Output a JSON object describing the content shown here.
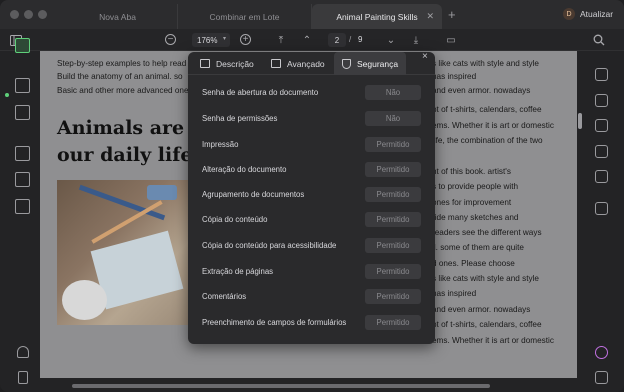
{
  "tabs": [
    {
      "label": "Nova Aba",
      "active": false
    },
    {
      "label": "Combinar em Lote",
      "active": false
    },
    {
      "label": "Animal Painting Skills",
      "active": true
    }
  ],
  "header": {
    "update_avatar": "D",
    "update_label": "Atualizar"
  },
  "toolbar": {
    "zoom": "176%",
    "page_current": "2",
    "page_sep": "/",
    "page_total": "9"
  },
  "document": {
    "top_lines": [
      "Step-by-step examples to help read",
      "Build the anatomy of an animal. so",
      "Basic and other more advanced one"
    ],
    "title_lines": [
      "Animals are a",
      "our daily life"
    ],
    "right_lines": [
      "s like cats with style and style",
      "has inspired",
      "and even armor. nowadays",
      "pt of t-shirts, calendars, coffee",
      "ems. Whether it is art or domestic",
      "life, the combination of the two",
      "",
      "nt of this book. artist's",
      "s to provide people with",
      "ones for improvement",
      "ride many sketches and",
      "readers see the different ways",
      "ll. some of them are quite",
      "d ones. Please choose",
      "s like cats with style and style",
      "has inspired",
      "and even armor. nowadays",
      "pt of t-shirts, calendars, coffee",
      "ems. Whether it is art or domestic"
    ]
  },
  "properties": {
    "tabs": [
      "Descrição",
      "Avançado",
      "Segurança"
    ],
    "active_tab": "Segurança",
    "close": "×",
    "rows": [
      {
        "label": "Senha de abertura do documento",
        "value": "Não"
      },
      {
        "label": "Senha de permissões",
        "value": "Não"
      },
      {
        "label": "Impressão",
        "value": "Permitido"
      },
      {
        "label": "Alteração do documento",
        "value": "Permitido"
      },
      {
        "label": "Agrupamento de documentos",
        "value": "Permitido"
      },
      {
        "label": "Cópia do conteúdo",
        "value": "Permitido"
      },
      {
        "label": "Cópia do conteúdo para acessibilidade",
        "value": "Permitido"
      },
      {
        "label": "Extração de páginas",
        "value": "Permitido"
      },
      {
        "label": "Comentários",
        "value": "Permitido"
      },
      {
        "label": "Preenchimento de campos de formulários",
        "value": "Permitido"
      }
    ]
  },
  "icons": {
    "zoom_out": "−",
    "zoom_in": "+",
    "first_page": "⤒",
    "prev_page": "⌃",
    "next_page": "⌄",
    "last_page": "⤓",
    "comment": "▭",
    "search": "⌕"
  },
  "colors": {
    "accent": "#5fd07a",
    "popup_bg": "#2a2a2c",
    "doc_bg": "#8f8f91"
  }
}
